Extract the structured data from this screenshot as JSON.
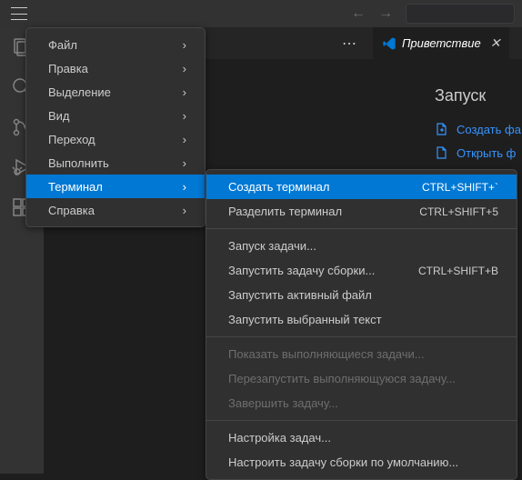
{
  "tab": {
    "title": "Приветствие"
  },
  "welcome": {
    "heading": "Запуск",
    "links": [
      "Создать фа",
      "Открыть ф"
    ]
  },
  "menu1": [
    {
      "label": "Файл"
    },
    {
      "label": "Правка"
    },
    {
      "label": "Выделение"
    },
    {
      "label": "Вид"
    },
    {
      "label": "Переход"
    },
    {
      "label": "Выполнить"
    },
    {
      "label": "Терминал",
      "active": true
    },
    {
      "label": "Справка"
    }
  ],
  "menu2": [
    {
      "label": "Создать терминал",
      "shortcut": "CTRL+SHIFT+`",
      "active": true
    },
    {
      "label": "Разделить терминал",
      "shortcut": "CTRL+SHIFT+5"
    },
    {
      "sep": true
    },
    {
      "label": "Запуск задачи..."
    },
    {
      "label": "Запустить задачу сборки...",
      "shortcut": "CTRL+SHIFT+B"
    },
    {
      "label": "Запустить активный файл"
    },
    {
      "label": "Запустить выбранный текст"
    },
    {
      "sep": true
    },
    {
      "label": "Показать выполняющиеся задачи...",
      "disabled": true
    },
    {
      "label": "Перезапустить выполняющуюся задачу...",
      "disabled": true
    },
    {
      "label": "Завершить задачу...",
      "disabled": true
    },
    {
      "sep": true
    },
    {
      "label": "Настройка задач..."
    },
    {
      "label": "Настроить задачу сборки по умолчанию..."
    }
  ]
}
